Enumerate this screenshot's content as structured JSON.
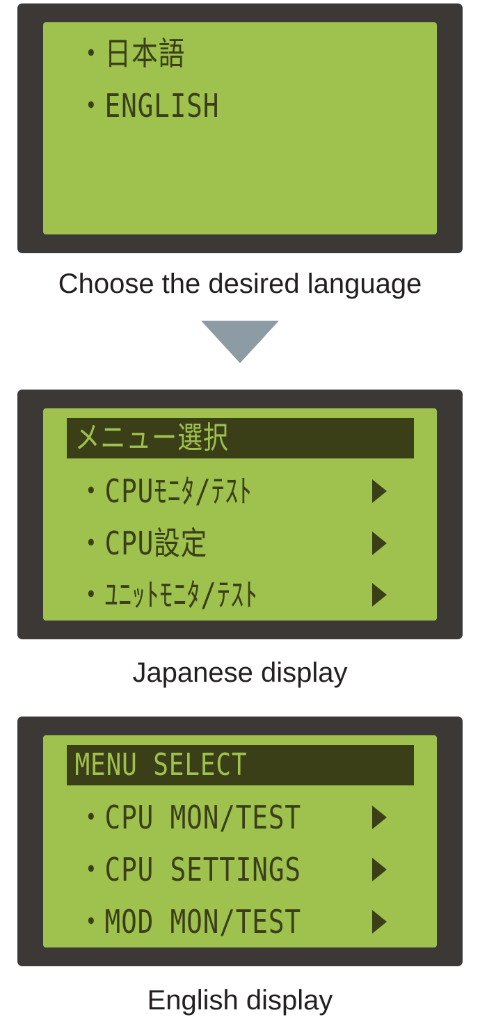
{
  "colors": {
    "lcd_background": "#9fc24e",
    "lcd_text": "#3b3f18",
    "bezel": "#3b3836",
    "arrow": "#8c9ba4",
    "caption_text": "#231f20"
  },
  "language_panel": {
    "options": [
      "・日本語",
      "・ENGLISH"
    ],
    "caption": "Choose the desired language"
  },
  "transition_icon": "down-triangle-icon",
  "japanese_panel": {
    "header": "メニュー選択",
    "items": [
      {
        "label": "・CPUﾓﾆﾀ/ﾃｽﾄ",
        "icon": "right-triangle-icon"
      },
      {
        "label": "・CPU設定",
        "icon": "right-triangle-icon"
      },
      {
        "label": "・ﾕﾆｯﾄﾓﾆﾀ/ﾃｽﾄ",
        "icon": "right-triangle-icon"
      }
    ],
    "caption": "Japanese display"
  },
  "english_panel": {
    "header": "MENU SELECT",
    "items": [
      {
        "label": "・CPU MON/TEST",
        "icon": "right-triangle-icon"
      },
      {
        "label": "・CPU SETTINGS",
        "icon": "right-triangle-icon"
      },
      {
        "label": "・MOD MON/TEST",
        "icon": "right-triangle-icon"
      }
    ],
    "caption": "English display"
  }
}
